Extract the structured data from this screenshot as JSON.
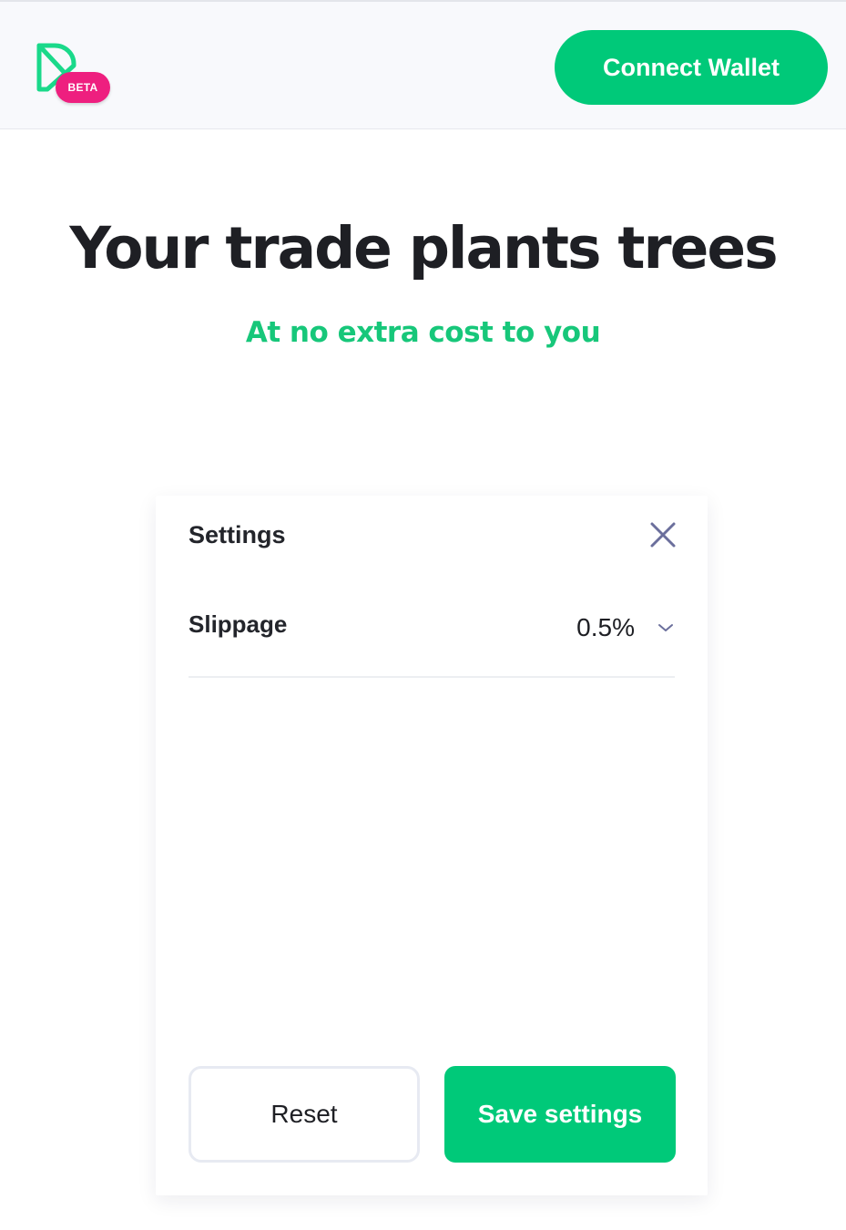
{
  "header": {
    "logo_icon": "play-leaf-logo-icon",
    "beta_badge": "BETA",
    "connect_wallet_label": "Connect Wallet"
  },
  "hero": {
    "title": "Your trade plants trees",
    "subtitle": "At no extra cost to you"
  },
  "settings_panel": {
    "title": "Settings",
    "close_icon": "close-icon",
    "slippage": {
      "label": "Slippage",
      "value": "0.5%",
      "dropdown_icon": "chevron-down-icon"
    },
    "reset_label": "Reset",
    "save_label": "Save settings"
  },
  "colors": {
    "brand_green": "#00c979",
    "beta_pink": "#ee1f7f",
    "close_icon": "#6b6f9c"
  }
}
